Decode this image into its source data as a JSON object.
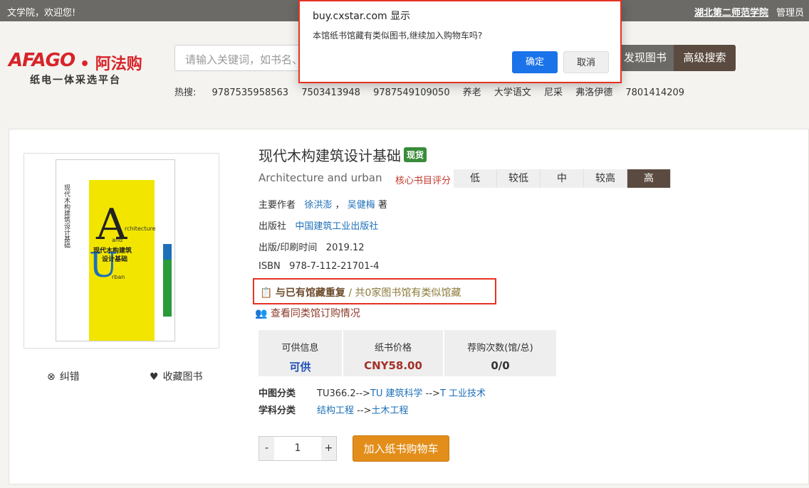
{
  "topbar": {
    "welcome": "文学院，欢迎您!",
    "school": "湖北第二师范学院",
    "admin": "管理员"
  },
  "logo": {
    "brand": "AFAGO",
    "brand_cn": "• 阿法购",
    "slogan": "纸电一体采选平台"
  },
  "search": {
    "placeholder": "请输入关键词，如书名、",
    "discover_label": "发现图书",
    "advanced_label": "高级搜索"
  },
  "hot": {
    "label": "热搜:",
    "items": [
      "9787535958563",
      "7503413948",
      "9787549109050",
      "养老",
      "大学语文",
      "尼采",
      "弗洛伊德",
      "7801414209"
    ]
  },
  "cover": {
    "vertical_title": "现代木构建筑设计基础",
    "word_a": "A",
    "word_a_rest": "rchitecture",
    "word_and": "and",
    "word_u": "U",
    "word_u_rest": "rban",
    "title_line1": "现代木构建筑",
    "title_line2": "设计基础"
  },
  "book": {
    "title": "现代木构建筑设计基础",
    "stock_badge": "现货",
    "subtitle": "Architecture and urban",
    "rating_label": "核心书目评分",
    "ratings": [
      "低",
      "较低",
      "中",
      "较高",
      "高"
    ],
    "author_label": "主要作者",
    "author1": "徐洪澎",
    "author_sep": "，",
    "author2": "吴健梅",
    "author_suffix": "著",
    "publisher_label": "出版社",
    "publisher": "中国建筑工业出版社",
    "date_label": "出版/印刷时间",
    "date": "2019.12",
    "isbn_label": "ISBN",
    "isbn": "978-7-112-21701-4",
    "dup_bold": "与已有馆藏重复",
    "dup_rest": " / 共0家图书馆有类似馆藏",
    "order_link": "查看同类馆订购情况"
  },
  "info": {
    "supply_header": "可供信息",
    "supply_value": "可供",
    "price_header": "纸书价格",
    "price_value": "CNY58.00",
    "order_header": "荐购次数(馆/总)",
    "order_value": "0/0"
  },
  "classification": {
    "cn_label": "中图分类",
    "cn_prefix": "TU366.2-->",
    "cn_link1": "TU 建筑科学",
    "cn_sep": " -->",
    "cn_link2": "T 工业技术",
    "subj_label": "学科分类",
    "subj_link1": "结构工程",
    "subj_sep": " -->",
    "subj_link2": "土木工程"
  },
  "actions": {
    "correct": "纠错",
    "favorite": "收藏图书",
    "qty_minus": "-",
    "qty_value": "1",
    "qty_plus": "+",
    "add_cart": "加入纸书购物车"
  },
  "dialog": {
    "title": "buy.cxstar.com 显示",
    "message": "本馆纸书馆藏有类似图书,继续加入购物车吗?",
    "ok": "确定",
    "cancel": "取消"
  }
}
